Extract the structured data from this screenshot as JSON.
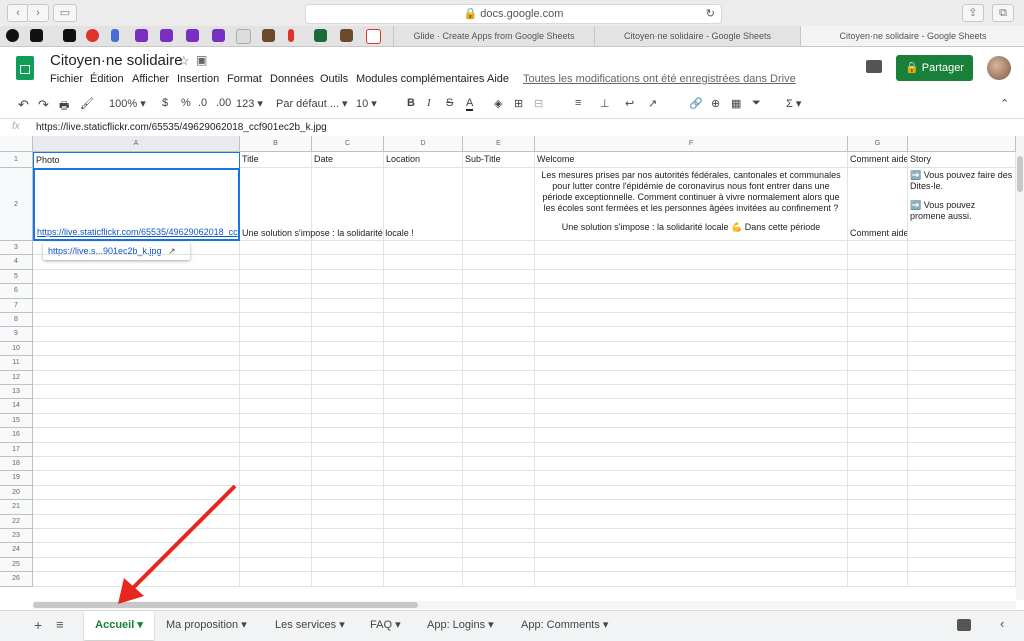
{
  "browser": {
    "address": "docs.google.com",
    "tabs": [
      "Glide · Create Apps from Google Sheets",
      "Citoyen·ne solidaire - Google Sheets",
      "Citoyen·ne solidaire - Google Sheets"
    ]
  },
  "doc": {
    "title": "Citoyen·ne solidaire",
    "menus": [
      "Fichier",
      "Édition",
      "Afficher",
      "Insertion",
      "Format",
      "Données",
      "Outils",
      "Modules complémentaires",
      "Aide"
    ],
    "saved_status": "Toutes les modifications ont été enregistrées dans Drive",
    "share_label": "Partager"
  },
  "toolbar": {
    "zoom": "100%",
    "currency": "$",
    "percent": "%",
    "dec_less": ".0",
    "dec_more": ".00",
    "format": "123",
    "font": "Par défaut ...",
    "font_size": "10"
  },
  "formula": {
    "fx": "fx",
    "value": "https://live.staticflickr.com/65535/49629062018_ccf901ec2b_k.jpg"
  },
  "columns": [
    "A",
    "B",
    "C",
    "D",
    "E",
    "F",
    "G"
  ],
  "headers": {
    "a": "Photo",
    "b": "Title",
    "c": "Date",
    "d": "Location",
    "e": "Sub-Title",
    "f": "Welcome",
    "g": "Comment aide",
    "h": "Story"
  },
  "row2": {
    "a": "https://live.staticflickr.com/65535/49629062018_cc",
    "b": "Une solution s'impose : la solidarité locale !",
    "f": "Les mesures prises par nos autorités fédérales, cantonales et communales pour lutter contre l'épidémie de coronavirus nous font entrer dans une période exceptionnelle. Comment continuer à vivre normalement alors que les écoles sont fermées et les personnes âgées invitées au confinement ?",
    "f2": "Une solution s'impose : la solidarité locale 💪 Dans cette période",
    "g": "Comment aide",
    "h1": "➡️ Vous pouvez faire des Dites-le.",
    "h2": "➡️ Vous pouvez promene aussi."
  },
  "link_chip": "https://live.s...901ec2b_k.jpg",
  "row_numbers": [
    "1",
    "2",
    "3",
    "4",
    "5",
    "6",
    "7",
    "8",
    "9",
    "10",
    "11",
    "12",
    "13",
    "14",
    "15",
    "16",
    "17",
    "18",
    "19",
    "20",
    "21",
    "22",
    "23",
    "24",
    "25",
    "26"
  ],
  "sheet_tabs": [
    "Accueil",
    "Ma proposition",
    "Les services",
    "FAQ",
    "App: Logins",
    "App: Comments"
  ],
  "colors": {
    "accent": "#188038",
    "active_tab": "#188038",
    "arrow": "#e8261e",
    "link": "#1155cc"
  }
}
